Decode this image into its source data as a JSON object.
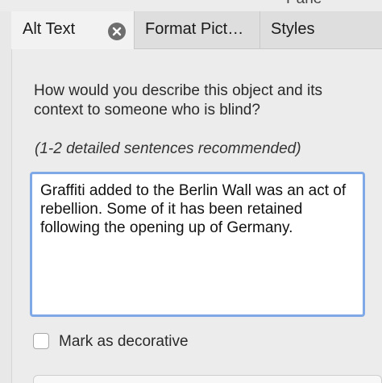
{
  "top_strip": {
    "partial_text": "Pane"
  },
  "tabs": [
    {
      "label": "Alt Text",
      "active": true
    },
    {
      "label": "Format Pict…",
      "active": false
    },
    {
      "label": "Styles",
      "active": false
    }
  ],
  "alt_text": {
    "question": "How would you describe this object and its context to someone who is blind?",
    "hint": "(1-2 detailed sentences recommended)",
    "description_value": "Graffiti added to the Berlin Wall was an act of rebellion. Some of it has been retained following the opening up of Germany.",
    "decorative_label": "Mark as decorative",
    "decorative_checked": false
  },
  "icons": {
    "tab_close": "close-icon"
  },
  "colors": {
    "focus_ring": "#7fa9e6",
    "panel_bg": "#ececec",
    "tab_bar_bg": "#dedede"
  }
}
